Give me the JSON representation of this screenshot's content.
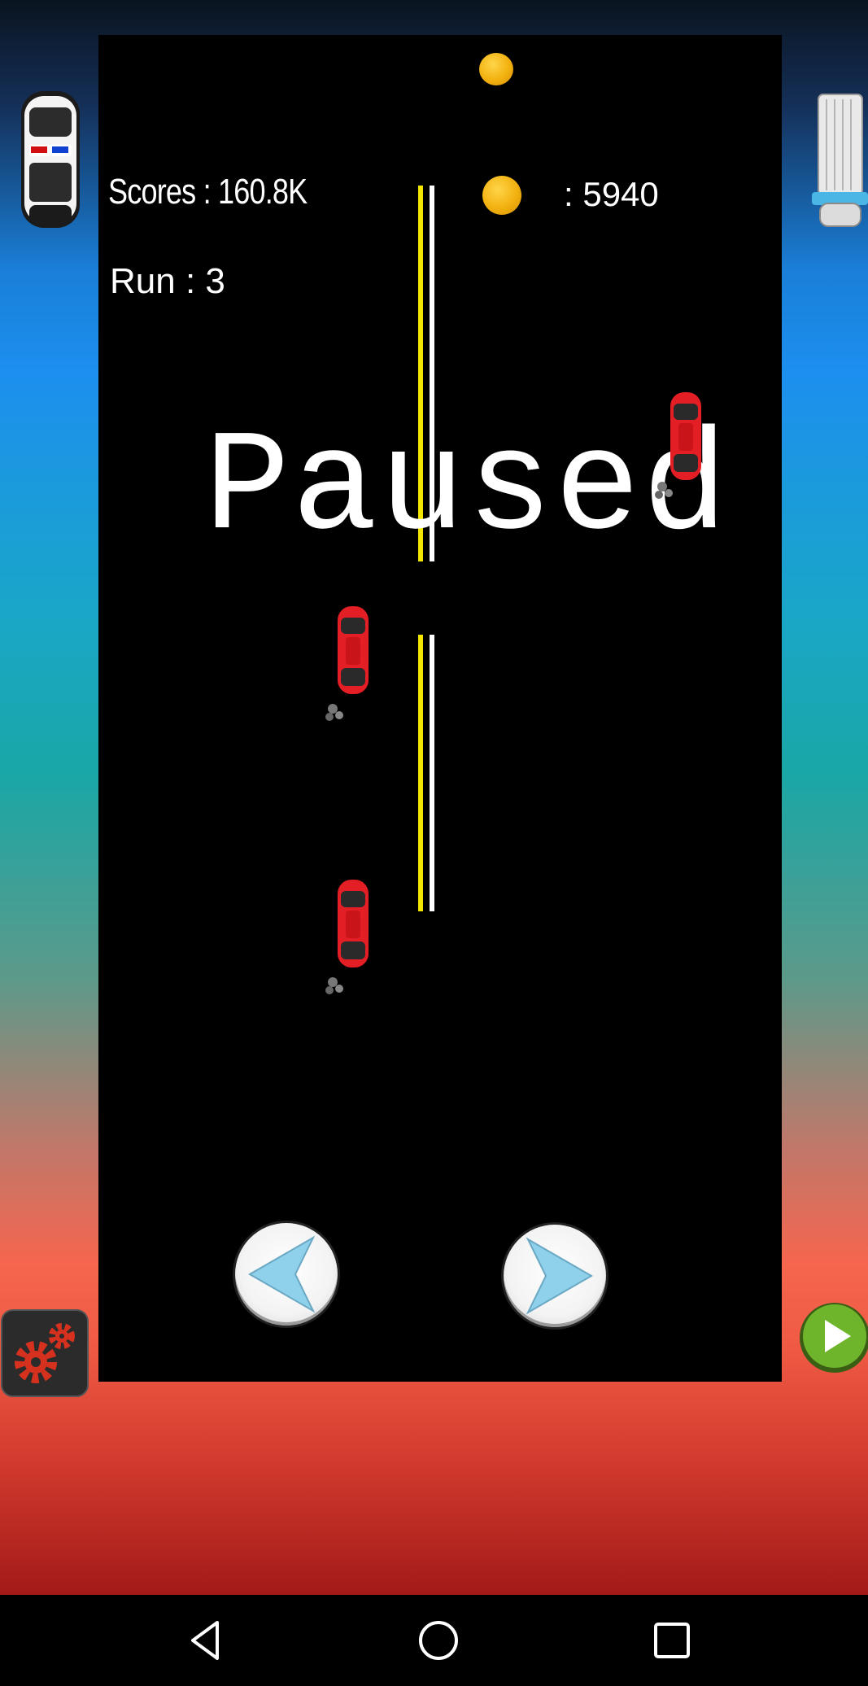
{
  "hud": {
    "score_label": "Scores : 160.8K",
    "run_label": "Run : 3",
    "coins_label": ": 5940"
  },
  "status": {
    "paused_label": "Paused"
  },
  "icons": {
    "left_car": "police-car-icon",
    "right_car": "truck-icon",
    "settings": "gear-icon",
    "play": "play-icon",
    "steer_left": "arrow-left-icon",
    "steer_right": "arrow-right-icon",
    "nav_back": "back-icon",
    "nav_home": "home-icon",
    "nav_recents": "recents-icon"
  },
  "colors": {
    "lane_yellow": "#f2e600",
    "lane_white": "#ffffff",
    "car_red": "#e31e24",
    "coin_gold": "#f2b10f",
    "play_green": "#6fb52c"
  }
}
